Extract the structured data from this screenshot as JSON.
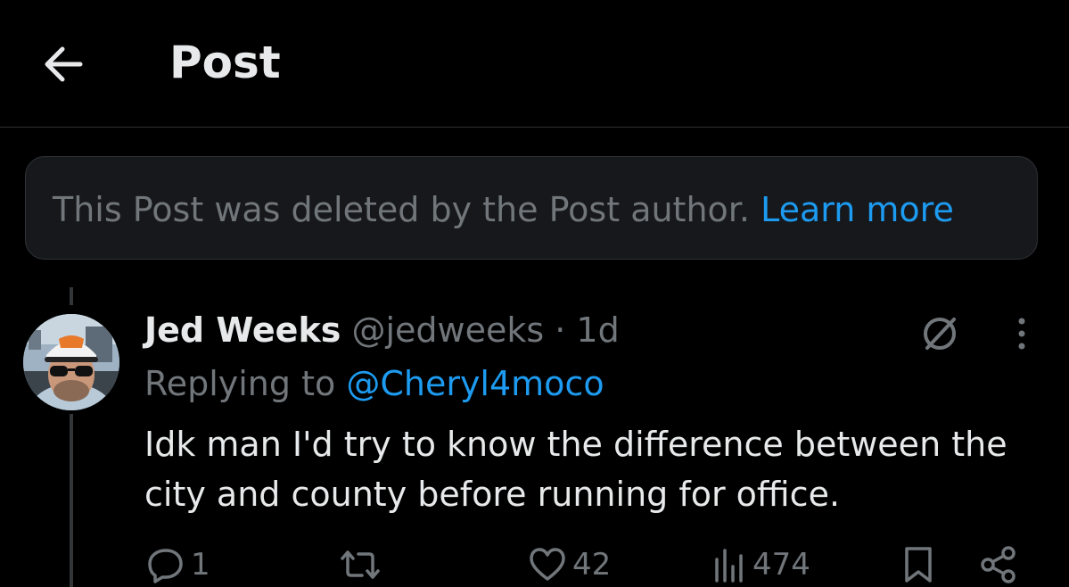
{
  "header": {
    "title": "Post",
    "back_icon": "arrow-left-icon"
  },
  "notice": {
    "text": "This Post was deleted by the Post author.",
    "link": "Learn more"
  },
  "post": {
    "author_name": "Jed Weeks",
    "author_handle": "@jedweeks",
    "separator": "·",
    "time": "1d",
    "replying_label": "Replying to",
    "replying_to": "@Cheryl4moco",
    "text": "Idk man I'd try to know the difference between the city and county before running for office.",
    "actions": {
      "replies": "1",
      "reposts": "",
      "likes": "42",
      "views": "474"
    }
  },
  "colors": {
    "background": "#000000",
    "text_primary": "#e7e9ea",
    "text_secondary": "#71767b",
    "accent": "#1d9bf0",
    "notice_bg": "#16181c",
    "border": "#2f3336"
  },
  "icons": [
    "arrow-left-icon",
    "grok-icon",
    "more-vertical-icon",
    "reply-icon",
    "repost-icon",
    "like-icon",
    "views-icon",
    "bookmark-icon",
    "share-icon"
  ]
}
